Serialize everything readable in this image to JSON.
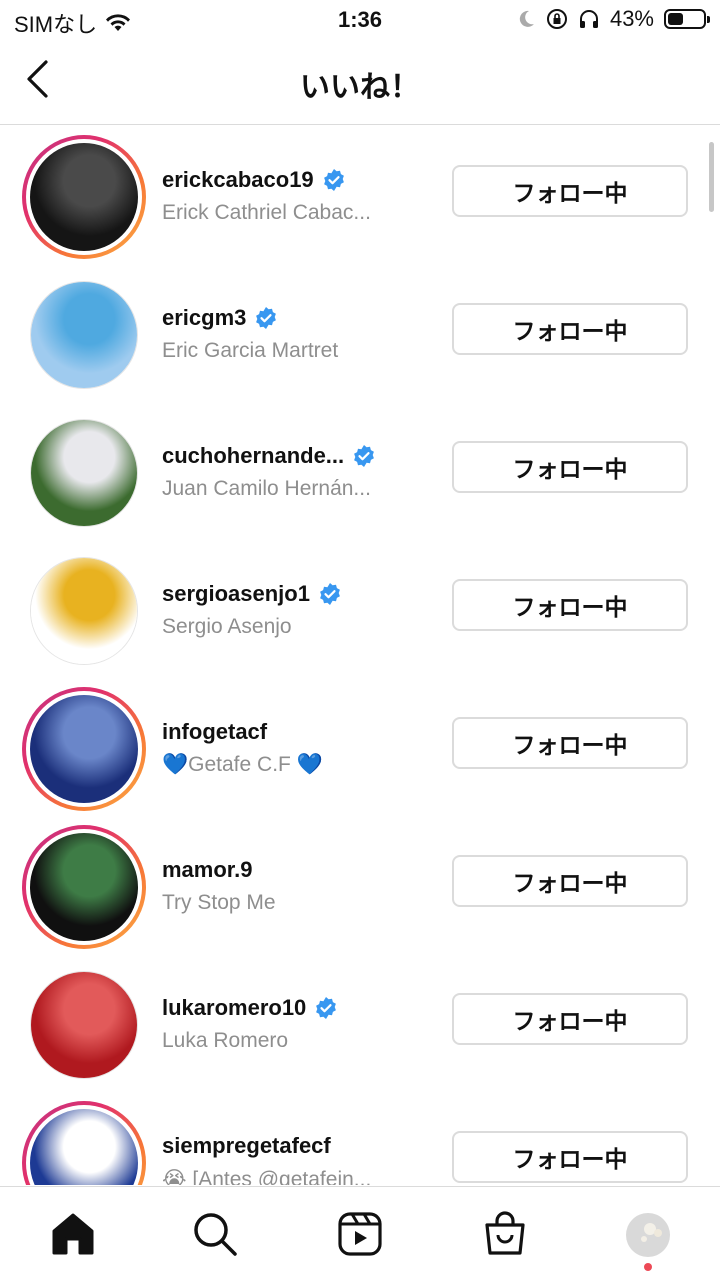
{
  "status": {
    "carrier": "SIMなし",
    "time": "1:36",
    "battery": "43%",
    "battery_level": 0.43
  },
  "header": {
    "title": "いいね！"
  },
  "follow_label": "フォロー中",
  "users": [
    {
      "username": "erickcabaco19",
      "fullname": "Erick Cathriel Cabac...",
      "verified": true,
      "story": true,
      "colors": [
        "#151515",
        "#4a4a4a"
      ]
    },
    {
      "username": "ericgm3",
      "fullname": "Eric Garcia Martret",
      "verified": true,
      "story": false,
      "colors": [
        "#9fcbef",
        "#4fa9e0"
      ]
    },
    {
      "username": "cuchohernande...",
      "fullname": "Juan Camilo Hernán...",
      "verified": true,
      "story": false,
      "colors": [
        "#3c6b2f",
        "#e8e8ec"
      ]
    },
    {
      "username": "sergioasenjo1",
      "fullname": "Sergio Asenjo",
      "verified": true,
      "story": false,
      "colors": [
        "#ffffff",
        "#e8b220"
      ]
    },
    {
      "username": "infogetacf",
      "fullname": "💙Getafe C.F 💙",
      "verified": false,
      "story": true,
      "colors": [
        "#1b2f7a",
        "#6a86c9"
      ]
    },
    {
      "username": "mamor.9",
      "fullname": "Try Stop Me",
      "verified": false,
      "story": true,
      "colors": [
        "#101010",
        "#3e7c46"
      ]
    },
    {
      "username": "lukaromero10",
      "fullname": "Luka Romero",
      "verified": true,
      "story": false,
      "colors": [
        "#b0191f",
        "#e25a5a"
      ]
    },
    {
      "username": "siempregetafecf",
      "fullname": "😭 [Antes @getafein...",
      "verified": false,
      "story": true,
      "colors": [
        "#1d3a94",
        "#ffffff"
      ]
    }
  ],
  "tabs": [
    "home-icon",
    "search-icon",
    "reels-icon",
    "shop-icon",
    "profile-avatar"
  ]
}
